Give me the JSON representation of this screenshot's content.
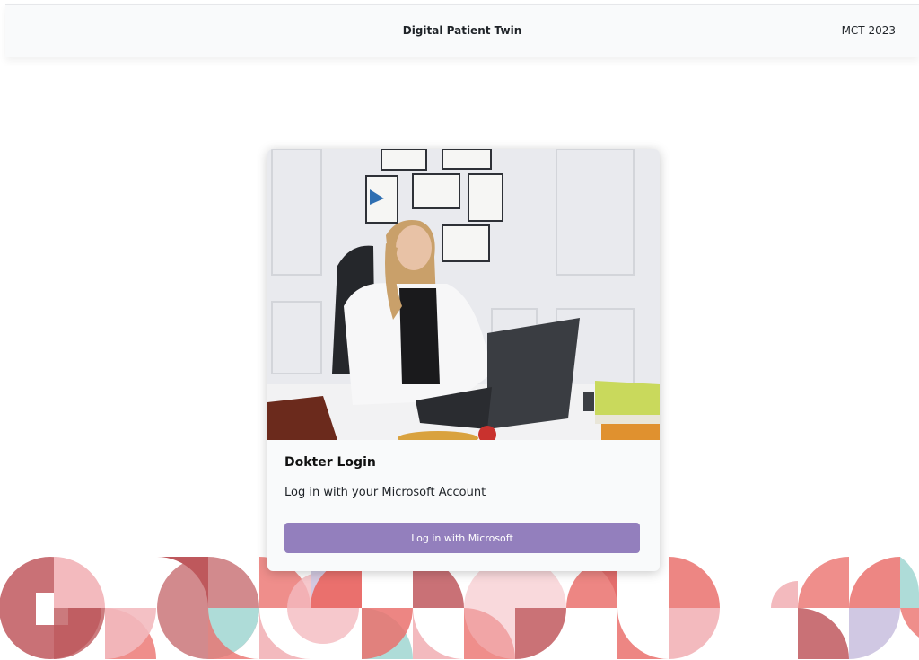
{
  "header": {
    "title": "Digital Patient Twin",
    "meta": "MCT 2023"
  },
  "login_card": {
    "title": "Dokter Login",
    "subtitle": "Log in with your Microsoft Account",
    "button_label": "Log in with Microsoft"
  },
  "colors": {
    "button": "#937fbd",
    "decor_red": "#e8615e",
    "decor_dark_red": "#b8474c",
    "decor_pink": "#f2b3b8",
    "decor_teal": "#a6d9d4",
    "decor_lavender": "#cbc3e0"
  }
}
